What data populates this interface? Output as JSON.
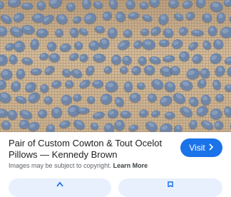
{
  "result": {
    "title": "Pair of Custom Cowton & Tout Ocelot Pillows — Kennedy Brown",
    "visit_label": "Visit",
    "visit_icon": "chevron-right-icon",
    "copyright_text": "Images may be subject to copyright.",
    "learn_more_label": "Learn More"
  },
  "image": {
    "spot_color": "#6f86a8",
    "spot_highlight": "#93a7c4",
    "spot_shadow": "#4c6284"
  },
  "bottom_actions": [
    {
      "icon": "share-icon"
    },
    {
      "icon": "save-icon"
    }
  ],
  "colors": {
    "accent": "#1a73e8"
  }
}
